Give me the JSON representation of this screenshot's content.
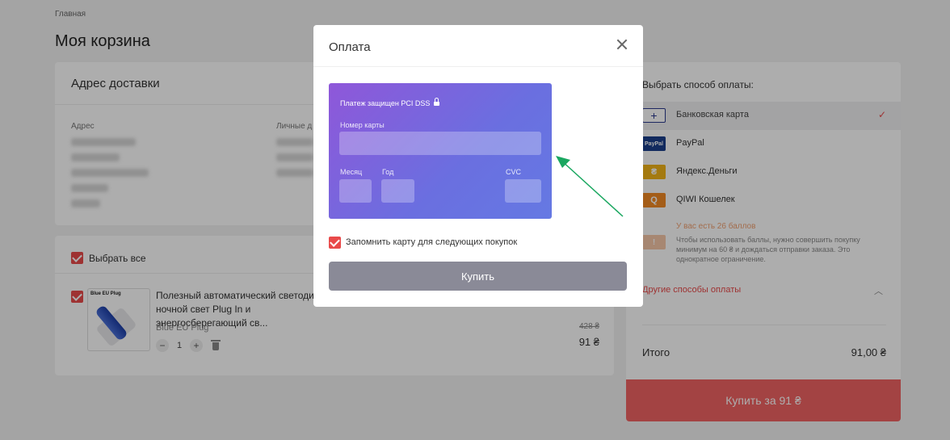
{
  "breadcrumb": "Главная",
  "page_title": "Моя корзина",
  "address": {
    "title": "Адрес доставки",
    "col1_label": "Адрес",
    "col2_label": "Личные д"
  },
  "cart": {
    "select_all": "Выбрать все",
    "thumb_caption": "Blue EU Plug",
    "product_title": "Полезный автоматический светодиод ночной свет Plug In и энергосберегающий св...",
    "product_sub": "Blue EU Plug",
    "qty": "1",
    "old_price": "428 ₴",
    "new_price": "91 ₴"
  },
  "payment_panel": {
    "title": "Выбрать способ оплаты:",
    "methods": [
      {
        "label": "Банковская карта",
        "icon": "+",
        "active": true,
        "color": "#ffffff"
      },
      {
        "label": "PayPal",
        "icon": "PayPal",
        "active": false,
        "color": "#1b3f8b"
      },
      {
        "label": "Яндекс.Деньги",
        "icon": "₴",
        "active": false,
        "color": "#f2b418"
      },
      {
        "label": "QIWI Кошелек",
        "icon": "Q",
        "active": false,
        "color": "#f28a24"
      }
    ],
    "bonus_title": "У вас есть 26 баллов",
    "bonus_text": "Чтобы использовать баллы, нужно совершить покупку минимум на 60 ₴ и дождаться отправки заказа. Это однократное ограничение.",
    "other_ways": "Другие способы оплаты",
    "total_label": "Итого",
    "total_value": "91,00 ₴",
    "buy_label": "Купить за 91 ₴"
  },
  "modal": {
    "title": "Оплата",
    "pci_text": "Платеж защищен PCI DSS",
    "card_number_label": "Номер карты",
    "month_label": "Месяц",
    "year_label": "Год",
    "cvc_label": "CVC",
    "remember_label": "Запомнить карту для следующих покупок",
    "buy_label": "Купить"
  },
  "colors": {
    "accent_red": "#e94a4a",
    "card_gradient_start": "#8f57d9",
    "card_gradient_end": "#6579e3",
    "arrow_green": "#1aa760"
  }
}
